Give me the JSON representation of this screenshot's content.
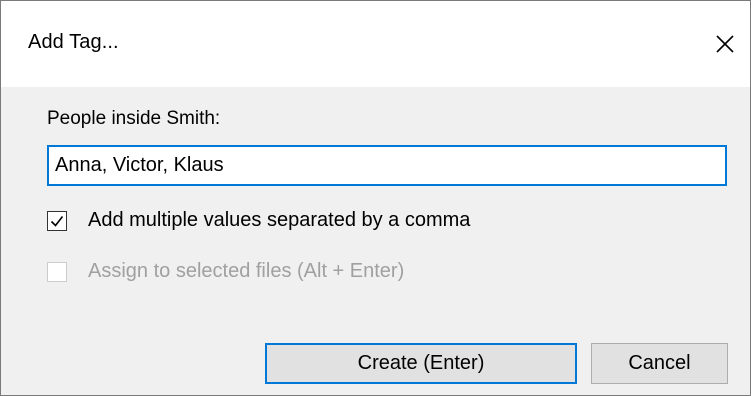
{
  "dialog": {
    "title": "Add Tag...",
    "close_icon": "close-icon",
    "field_label": "People inside Smith:",
    "input_value": "Anna, Victor, Klaus",
    "options": [
      {
        "label": "Add multiple values separated by a comma",
        "checked": true,
        "enabled": true
      },
      {
        "label": "Assign to selected files (Alt + Enter)",
        "checked": false,
        "enabled": false
      }
    ],
    "buttons": {
      "create_label": "Create (Enter)",
      "cancel_label": "Cancel"
    }
  },
  "colors": {
    "accent": "#0078d7",
    "body_background": "#f0f0f0",
    "titlebar_background": "#ffffff",
    "disabled_text": "#a0a0a0",
    "button_face": "#e1e1e1"
  }
}
